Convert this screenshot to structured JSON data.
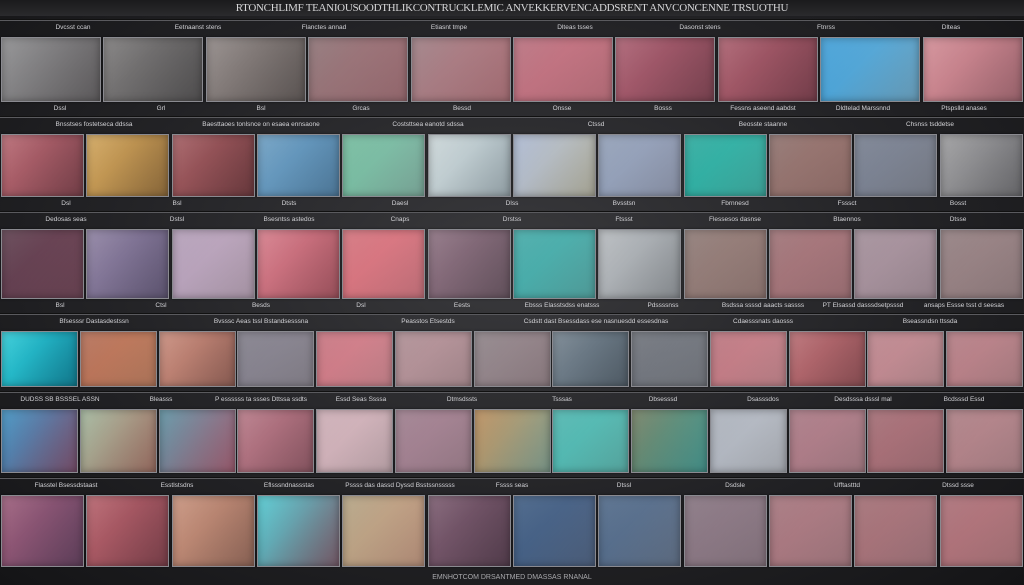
{
  "title": "RTONCHLIMF TEANIOUSOODTHLIKCONTRUCKLEMIC ANVEKKERVENCADDSRENT ANVCONCENNE TRSUOTHU",
  "footer": "EMNHOTCOM DRSANTMED DMASSAS RNANAL",
  "rows": [
    {
      "top_labels": [
        "Dvcsst ccan",
        "Eetnaanst stens",
        "Flanctes annad",
        "Etiasnt tmpe",
        "Dlteas tsses",
        "Dasonst stens",
        "Ftnrss",
        "Dlteas"
      ],
      "bottom_labels": [
        "Dssl",
        "Grl",
        "Bsl",
        "Grcas",
        "Bessd",
        "Onsse",
        "Bosss",
        "Fessns aseend aabdst",
        "Dldtelad Marssnnd",
        "Ptspslld anases"
      ],
      "colors": [
        [
          "#8a8a8c",
          "#6f6c6e"
        ],
        [
          "#7a7878",
          "#5f5d5e"
        ],
        [
          "#8d8583",
          "#6d6563"
        ],
        [
          "#8a6f72",
          "#b07b82"
        ],
        [
          "#9a7a80",
          "#c08088"
        ],
        [
          "#b56c7a",
          "#d27e8c"
        ],
        [
          "#a85c6e",
          "#8e4e5e"
        ],
        [
          "#a85c6b",
          "#8b4a59"
        ],
        [
          "#3a9bd5",
          "#7ab7d8"
        ],
        [
          "#d08a93",
          "#b57580"
        ]
      ]
    },
    {
      "top_labels": [
        "Bnsstses fostetseca ddssa",
        "Baesttaoes tonlsnce on esaea ennsaone",
        "Coststtsea eanotd sdssa",
        "Ctssd",
        "Beosste staanne",
        "Chsnss tsddetse"
      ],
      "bottom_labels": [
        "Dsl",
        "Bsl",
        "Dtsts",
        "Daesl",
        "Dlss",
        "Bvsstsn",
        "Fbrnnesd",
        "Fsssct",
        "Bosst"
      ],
      "colors": [
        [
          "#b5656f",
          "#8a4b56"
        ],
        [
          "#d0a45a",
          "#a37b45"
        ],
        [
          "#a25b60",
          "#7d4449"
        ],
        [
          "#6a9cc0",
          "#5c8eb5"
        ],
        [
          "#6fb89a",
          "#8fc2b2"
        ],
        [
          "#c9d4d6",
          "#aebec5"
        ],
        [
          "#a9b6d0",
          "#c5c3b0"
        ],
        [
          "#8e9cb4",
          "#9fa8c0"
        ],
        [
          "#27a69a",
          "#48c0b4"
        ],
        [
          "#8b6e6a",
          "#a57d78"
        ],
        [
          "#737b8c",
          "#8a8f9c"
        ],
        [
          "#9a9a9c",
          "#7a7a7e"
        ]
      ]
    },
    {
      "top_labels": [
        "Dedosas seas",
        "Dstsl",
        "Bsesntss astedos",
        "Cnaps",
        "Drstss",
        "Ftssst",
        "Flessesos dasnse",
        "Btaennos",
        "Dtsse"
      ],
      "bottom_labels": [
        "Bsl",
        "Ctsl",
        "Besds",
        "Dsl",
        "Eests",
        "Ebsss Elasstsdss enatsss",
        "Pdssssnss",
        "Bsdssa ssssd aaacts sassss",
        "PT Elsassd dasssdsetpsssd",
        "ansaps Essse tsst d seesas"
      ],
      "colors": [
        [
          "#5a3a4a",
          "#7a4e60"
        ],
        [
          "#8c7fa0",
          "#6f6485"
        ],
        [
          "#b09bb5",
          "#c6b0c4"
        ],
        [
          "#d47a88",
          "#b7606d"
        ],
        [
          "#d06e78",
          "#e2838e"
        ],
        [
          "#8a6e7e",
          "#76616e"
        ],
        [
          "#3fa6a4",
          "#5fb9b6"
        ],
        [
          "#b4b8bc",
          "#9ea3a8"
        ],
        [
          "#8a7672",
          "#a38782"
        ],
        [
          "#9a6e72",
          "#b58187"
        ],
        [
          "#9e8a95",
          "#b39da8"
        ],
        [
          "#8e7a7c",
          "#a58e90"
        ]
      ]
    },
    {
      "top_labels": [
        "Bfsesssr Dastasdestssn",
        "Bvsssc Aeas tssl Bstandsesssna",
        "Peasstos Etsestds",
        "Csdstt dast Bsessdass ese nasnuesdd essesdnas",
        "Cdaesssnats daosss",
        "Bseassndsn ttssda"
      ],
      "bottom_labels": [],
      "colors": [
        [
          "#2ccad6",
          "#1590a8"
        ],
        [
          "#b06a52",
          "#cd8a6a"
        ],
        [
          "#c78a7a",
          "#a36d62"
        ],
        [
          "#7d7a86",
          "#98939e"
        ],
        [
          "#c4707c",
          "#e0949e"
        ],
        [
          "#aa8a90",
          "#c09ea4"
        ],
        [
          "#8a7f84",
          "#a28f95"
        ],
        [
          "#72808c",
          "#5f6d79"
        ],
        [
          "#6a6e76",
          "#848890"
        ],
        [
          "#b7707a",
          "#d6949c"
        ],
        [
          "#b66a70",
          "#9e5a60"
        ],
        [
          "#b88088",
          "#cc9aa0"
        ],
        [
          "#b07880",
          "#c49096"
        ]
      ]
    },
    {
      "top_labels": [
        "DUDSS SB BSSSEL ASSN",
        "Bleasss",
        "P essssss ta ssses Dttssa ssdts",
        "Essd Seas Ssssa",
        "Dtmsdssts",
        "Tsssas",
        "Dbsesssd",
        "Dsasssdos",
        "Desdsssa dsssl mal",
        "Bcdsssd Essd"
      ],
      "bottom_labels": [],
      "colors": [
        [
          "#3a8fc0",
          "#8a5a7a"
        ],
        [
          "#9fb49a",
          "#b07d70"
        ],
        [
          "#5a8fa0",
          "#b36a80"
        ],
        [
          "#b57785",
          "#9f6472"
        ],
        [
          "#c9aab2",
          "#d8bcc3"
        ],
        [
          "#9a7a8a",
          "#b08e9d"
        ],
        [
          "#b88a58",
          "#8fb0a0"
        ],
        [
          "#4ab2ac",
          "#66c4bc"
        ],
        [
          "#6f7a5e",
          "#4fa8a0"
        ],
        [
          "#a8aeb8",
          "#c3c7cf"
        ],
        [
          "#a57480",
          "#bb8c96"
        ],
        [
          "#9f6870",
          "#b47c84"
        ],
        [
          "#a87a80",
          "#c09298"
        ]
      ]
    },
    {
      "top_labels": [
        "Flasstel Bsessdstaast",
        "Esstlstsdns",
        "Eflsssndnassstas",
        "Pssss das dassd Dyssd Bsstssnsssss",
        "Fssss seas",
        "Dtssl",
        "Dsdsle",
        "Ufftastttd",
        "Dtssd ssse"
      ],
      "bottom_labels": [],
      "colors": [
        [
          "#9a5a78",
          "#6f4a6a"
        ],
        [
          "#b5606a",
          "#8d4a56"
        ],
        [
          "#c6907a",
          "#a47565"
        ],
        [
          "#4ec8d0",
          "#8a6a7a"
        ],
        [
          "#b0a080",
          "#d0a48c"
        ],
        [
          "#7a5a6e",
          "#62485a"
        ],
        [
          "#3c5a80",
          "#5a6f90"
        ],
        [
          "#4b6585",
          "#6e7f98"
        ],
        [
          "#82707c",
          "#9a8692"
        ],
        [
          "#a07078",
          "#b88890"
        ],
        [
          "#9e6a70",
          "#b4828a"
        ],
        [
          "#a66a72",
          "#bd8288"
        ]
      ]
    }
  ]
}
